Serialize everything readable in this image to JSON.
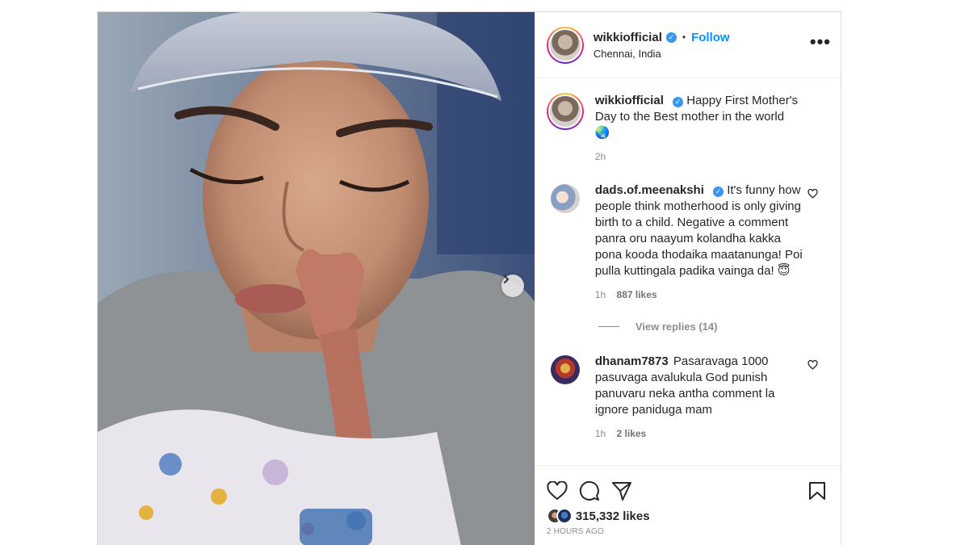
{
  "header": {
    "username": "wikkiofficial",
    "follow_label": "Follow",
    "separator": "•",
    "location": "Chennai, India",
    "more_label": "•••"
  },
  "caption": {
    "username": "wikkiofficial",
    "text": "Happy First Mother's Day to the Best mother in the world",
    "emoji": "🌏",
    "time": "2h"
  },
  "comments": [
    {
      "username": "dads.of.meenakshi",
      "verified": true,
      "text": "It's funny how people think motherhood is only giving birth to a child. Negative a comment panra oru naayum kolandha kakka pona kooda thodaika maatanunga! Poi pulla kuttingala padika vainga da! 😇",
      "time": "1h",
      "likes": "887 likes",
      "view_replies": "View replies (14)"
    },
    {
      "username": "dhanam7873",
      "verified": false,
      "text": "Pasaravaga 1000 pasuvaga avalukula God punish panuvaru neka antha comment la ignore paniduga mam",
      "time": "1h",
      "likes": "2 likes"
    }
  ],
  "footer": {
    "likes": "315,332 likes",
    "time_ago": "2 HOURS AGO"
  },
  "colors": {
    "link_blue": "#0095f6",
    "verified_blue": "#3897f0",
    "muted": "#8e8e8e"
  },
  "icons": [
    "like-icon",
    "comment-icon",
    "share-icon",
    "save-icon",
    "verified-icon",
    "chevron-right-icon",
    "heart-outline-icon"
  ]
}
